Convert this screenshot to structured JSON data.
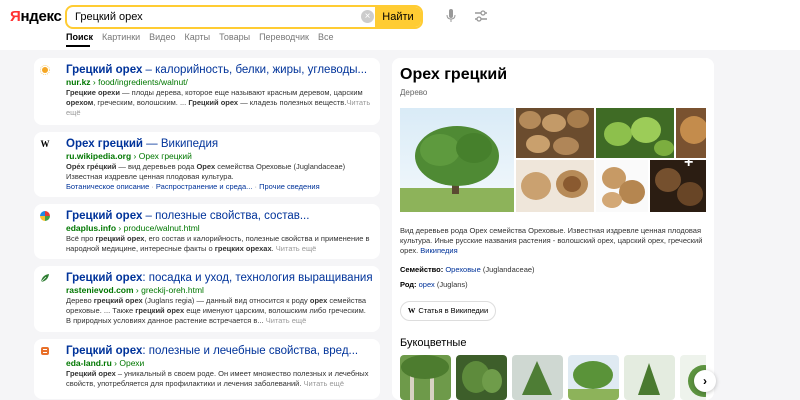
{
  "header": {
    "logo_first": "Я",
    "logo_rest": "ндекс",
    "search_value": "Грецкий орех",
    "search_button": "Найти",
    "clear_icon": "close-icon",
    "mic_icon": "microphone-icon",
    "filter_icon": "filter-sliders-icon"
  },
  "tabs": [
    "Поиск",
    "Картинки",
    "Видео",
    "Карты",
    "Товары",
    "Переводчик",
    "Все"
  ],
  "results": [
    {
      "title_bold": "Грецкий орех",
      "title_rest": " – калорийность, белки, жиры, углеводы...",
      "domain": "nur.kz",
      "path": " › food/ingredients/walnut/",
      "snippet": [
        {
          "t": "Грецкие орехи",
          "b": true
        },
        {
          "t": " — плоды дерева, которое еще называют красным деревом, царским ",
          "b": false
        },
        {
          "t": "орехом",
          "b": true
        },
        {
          "t": ", греческим, волошским. ... ",
          "b": false
        },
        {
          "t": "Грецкий орех",
          "b": true
        },
        {
          "t": " — кладезь полезных веществ.",
          "b": false
        }
      ],
      "more": "Читать ещё",
      "links": []
    },
    {
      "title_bold": "Орех грецкий",
      "title_rest": " — Википедия",
      "domain": "ru.wikipedia.org",
      "path": " › Орех грецкий",
      "snippet": [
        {
          "t": "Оре́х гре́цкий",
          "b": true
        },
        {
          "t": " — вид деревьев рода ",
          "b": false
        },
        {
          "t": "Орех",
          "b": true
        },
        {
          "t": " семейства Ореховые (Juglandaceae) Известная издревле ценная плодовая культура.",
          "b": false
        }
      ],
      "more": "",
      "links": [
        "Ботаническое описание",
        " · ",
        "Распространение и среда...",
        " · ",
        "Прочие сведения"
      ]
    },
    {
      "title_bold": "Грецкий орех",
      "title_rest": " – полезные свойства, состав...",
      "domain": "edaplus.info",
      "path": " › produce/walnut.html",
      "snippet": [
        {
          "t": "Всё про ",
          "b": false
        },
        {
          "t": "грецкий орех",
          "b": true
        },
        {
          "t": ", его состав и калорийность, полезные свойства и применение в народной медицине, интересные факты о ",
          "b": false
        },
        {
          "t": "грецких орехах",
          "b": true
        },
        {
          "t": ". ",
          "b": false
        }
      ],
      "more": "Читать ещё",
      "links": []
    },
    {
      "title_bold": "Грецкий орех",
      "title_rest": ": посадка и уход, технология выращивания...",
      "domain": "rastenievod.com",
      "path": " › greckij-oreh.html",
      "snippet": [
        {
          "t": "Дерево ",
          "b": false
        },
        {
          "t": "грецкий орех",
          "b": true
        },
        {
          "t": " (Juglans regia) — данный вид относится к роду ",
          "b": false
        },
        {
          "t": "орех",
          "b": true
        },
        {
          "t": " семейства ореховые. ... Также ",
          "b": false
        },
        {
          "t": "грецкий орех",
          "b": true
        },
        {
          "t": " еще именуют царским, волошским либо греческим. В природных условиях данное растение встречается в... ",
          "b": false
        }
      ],
      "more": "Читать ещё",
      "links": []
    },
    {
      "title_bold": "Грецкий орех",
      "title_rest": ": полезные и лечебные свойства, вред...",
      "domain": "eda-land.ru",
      "path": " › Орехи",
      "snippet": [
        {
          "t": "Грецкий орех",
          "b": true
        },
        {
          "t": " – уникальный в своем роде. Он имеет множество полезных и лечебных свойств, употребляется для профилактики и лечения заболеваний. ",
          "b": false
        }
      ],
      "more": "Читать ещё",
      "links": []
    }
  ],
  "knowledge_panel": {
    "title": "Орех грецкий",
    "subtitle": "Дерево",
    "description": "Вид деревьев рода Орех семейства Ореховые. Известная издревле ценная плодовая культура. Иные русские названия растения - волошский орех, царский орех, греческий орех. ",
    "description_link": "Википедия",
    "family_label": "Семейство: ",
    "family_value": "Ореховые",
    "family_latin": " (Juglandaceae)",
    "genus_label": "Род: ",
    "genus_value": "орех",
    "genus_latin": " (Juglans)",
    "wiki_button": "Статья в Википедии",
    "related_title": "Букоцветные"
  },
  "colors": {
    "accent": "#ffcc33",
    "link": "#00339a",
    "url_green": "#007700"
  }
}
